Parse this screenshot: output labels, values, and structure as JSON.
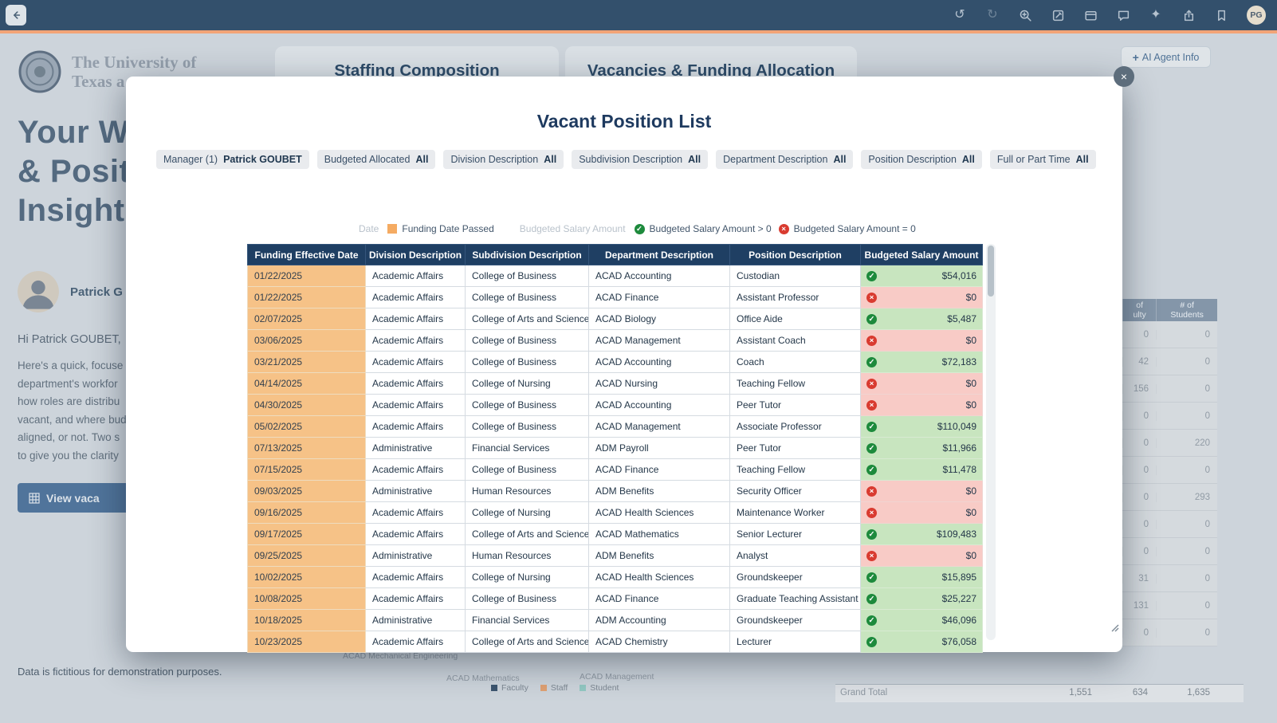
{
  "colors": {
    "accent_orange": "#f2a477",
    "navy_header": "#1f3f63",
    "funding_passed_cell": "#f6c287",
    "salary_positive_cell": "#c8e5bf",
    "salary_zero_cell": "#f8cbc6",
    "positive_icon": "#1d8a3c",
    "negative_icon": "#d93b30"
  },
  "topbar": {
    "avatar": "PG",
    "icons": [
      "undo-icon",
      "redo-icon",
      "zoom-in-icon",
      "edit-icon",
      "card-icon",
      "comment-icon",
      "sparkle-icon",
      "export-icon",
      "bookmark-icon"
    ]
  },
  "background": {
    "university": {
      "line1": "The University of",
      "line2": "Texas a"
    },
    "tabs": [
      {
        "label": "Staffing Composition"
      },
      {
        "label": "Vacancies & Funding Allocation"
      }
    ],
    "ai_agent_button": {
      "plus": "+",
      "label": "AI Agent Info"
    },
    "heading_lines": [
      "Your W",
      "& Posit",
      "Insights"
    ],
    "profile_name": "Patrick G",
    "greeting": "Hi Patrick GOUBET,",
    "paragraph_lines": [
      "Here's a quick, focuse",
      "department's workfor",
      "how roles are distribu",
      "vacant, and where bud",
      "aligned, or not. Two s",
      "to give you the clarity"
    ],
    "view_button": "View vaca",
    "footer_note": "Data is fictitious for demonstration purposes.",
    "side_table": {
      "col_headers": [
        [
          "of",
          "ulty"
        ],
        [
          "# of",
          "Students"
        ]
      ],
      "rows": [
        [
          "0",
          "0"
        ],
        [
          "42",
          "0"
        ],
        [
          "156",
          "0"
        ],
        [
          "0",
          "0"
        ],
        [
          "0",
          "220"
        ],
        [
          "0",
          "0"
        ],
        [
          "0",
          "293"
        ],
        [
          "0",
          "0"
        ],
        [
          "0",
          "0"
        ],
        [
          "31",
          "0"
        ],
        [
          "131",
          "0"
        ],
        [
          "0",
          "0"
        ]
      ],
      "grand_total_label": "Grand Total",
      "grand_total_values": [
        "1,551",
        "634",
        "1,635"
      ]
    },
    "chart_labels": [
      "ACAD Mechanical Engineering",
      "ACAD Mathematics",
      "ACAD Management"
    ],
    "chart_legend": [
      {
        "label": "Faculty",
        "color": "#3c556f"
      },
      {
        "label": "Staff",
        "color": "#dfa173"
      },
      {
        "label": "Student",
        "color": "#92c8c2"
      }
    ]
  },
  "modal": {
    "title": "Vacant Position List",
    "close_glyph": "×",
    "filters": [
      {
        "label": "Manager (1)",
        "value": "Patrick GOUBET"
      },
      {
        "label": "Budgeted Allocated",
        "value": "All"
      },
      {
        "label": "Division Description",
        "value": "All"
      },
      {
        "label": "Subdivision Description",
        "value": "All"
      },
      {
        "label": "Department Description",
        "value": "All"
      },
      {
        "label": "Position Description",
        "value": "All"
      },
      {
        "label": "Full or Part Time",
        "value": "All"
      }
    ],
    "legend": {
      "date_group_label": "Date",
      "funding_passed_label": "Funding Date Passed",
      "salary_group_label": "Budgeted Salary Amount",
      "salary_positive_label": "Budgeted Salary Amount > 0",
      "salary_zero_label": "Budgeted Salary Amount = 0"
    },
    "table": {
      "headers": [
        "Funding Effective Date",
        "Division Description",
        "Subdivision Description",
        "Department Description",
        "Position Description",
        "Budgeted Salary Amount"
      ],
      "rows": [
        {
          "funding_date": "01/22/2025",
          "division": "Academic Affairs",
          "subdivision": "College of Business",
          "department": "ACAD Accounting",
          "position": "Custodian",
          "salary": "$54,016",
          "salary_positive": true
        },
        {
          "funding_date": "01/22/2025",
          "division": "Academic Affairs",
          "subdivision": "College of Business",
          "department": "ACAD Finance",
          "position": "Assistant Professor",
          "salary": "$0",
          "salary_positive": false
        },
        {
          "funding_date": "02/07/2025",
          "division": "Academic Affairs",
          "subdivision": "College of Arts and Sciences",
          "department": "ACAD Biology",
          "position": "Office Aide",
          "salary": "$5,487",
          "salary_positive": true
        },
        {
          "funding_date": "03/06/2025",
          "division": "Academic Affairs",
          "subdivision": "College of Business",
          "department": "ACAD Management",
          "position": "Assistant Coach",
          "salary": "$0",
          "salary_positive": false
        },
        {
          "funding_date": "03/21/2025",
          "division": "Academic Affairs",
          "subdivision": "College of Business",
          "department": "ACAD Accounting",
          "position": "Coach",
          "salary": "$72,183",
          "salary_positive": true
        },
        {
          "funding_date": "04/14/2025",
          "division": "Academic Affairs",
          "subdivision": "College of Nursing",
          "department": "ACAD Nursing",
          "position": "Teaching Fellow",
          "salary": "$0",
          "salary_positive": false
        },
        {
          "funding_date": "04/30/2025",
          "division": "Academic Affairs",
          "subdivision": "College of Business",
          "department": "ACAD Accounting",
          "position": "Peer Tutor",
          "salary": "$0",
          "salary_positive": false
        },
        {
          "funding_date": "05/02/2025",
          "division": "Academic Affairs",
          "subdivision": "College of Business",
          "department": "ACAD Management",
          "position": "Associate Professor",
          "salary": "$110,049",
          "salary_positive": true
        },
        {
          "funding_date": "07/13/2025",
          "division": "Administrative",
          "subdivision": "Financial Services",
          "department": "ADM Payroll",
          "position": "Peer Tutor",
          "salary": "$11,966",
          "salary_positive": true
        },
        {
          "funding_date": "07/15/2025",
          "division": "Academic Affairs",
          "subdivision": "College of Business",
          "department": "ACAD Finance",
          "position": "Teaching Fellow",
          "salary": "$11,478",
          "salary_positive": true
        },
        {
          "funding_date": "09/03/2025",
          "division": "Administrative",
          "subdivision": "Human Resources",
          "department": "ADM Benefits",
          "position": "Security Officer",
          "salary": "$0",
          "salary_positive": false
        },
        {
          "funding_date": "09/16/2025",
          "division": "Academic Affairs",
          "subdivision": "College of Nursing",
          "department": "ACAD Health Sciences",
          "position": "Maintenance Worker",
          "salary": "$0",
          "salary_positive": false
        },
        {
          "funding_date": "09/17/2025",
          "division": "Academic Affairs",
          "subdivision": "College of Arts and Sciences",
          "department": "ACAD Mathematics",
          "position": "Senior Lecturer",
          "salary": "$109,483",
          "salary_positive": true
        },
        {
          "funding_date": "09/25/2025",
          "division": "Administrative",
          "subdivision": "Human Resources",
          "department": "ADM Benefits",
          "position": "Analyst",
          "salary": "$0",
          "salary_positive": false
        },
        {
          "funding_date": "10/02/2025",
          "division": "Academic Affairs",
          "subdivision": "College of Nursing",
          "department": "ACAD Health Sciences",
          "position": "Groundskeeper",
          "salary": "$15,895",
          "salary_positive": true
        },
        {
          "funding_date": "10/08/2025",
          "division": "Academic Affairs",
          "subdivision": "College of Business",
          "department": "ACAD Finance",
          "position": "Graduate Teaching Assistant",
          "salary": "$25,227",
          "salary_positive": true
        },
        {
          "funding_date": "10/18/2025",
          "division": "Administrative",
          "subdivision": "Financial Services",
          "department": "ADM Accounting",
          "position": "Groundskeeper",
          "salary": "$46,096",
          "salary_positive": true
        },
        {
          "funding_date": "10/23/2025",
          "division": "Academic Affairs",
          "subdivision": "College of Arts and Sciences",
          "department": "ACAD Chemistry",
          "position": "Lecturer",
          "salary": "$76,058",
          "salary_positive": true
        }
      ]
    }
  }
}
